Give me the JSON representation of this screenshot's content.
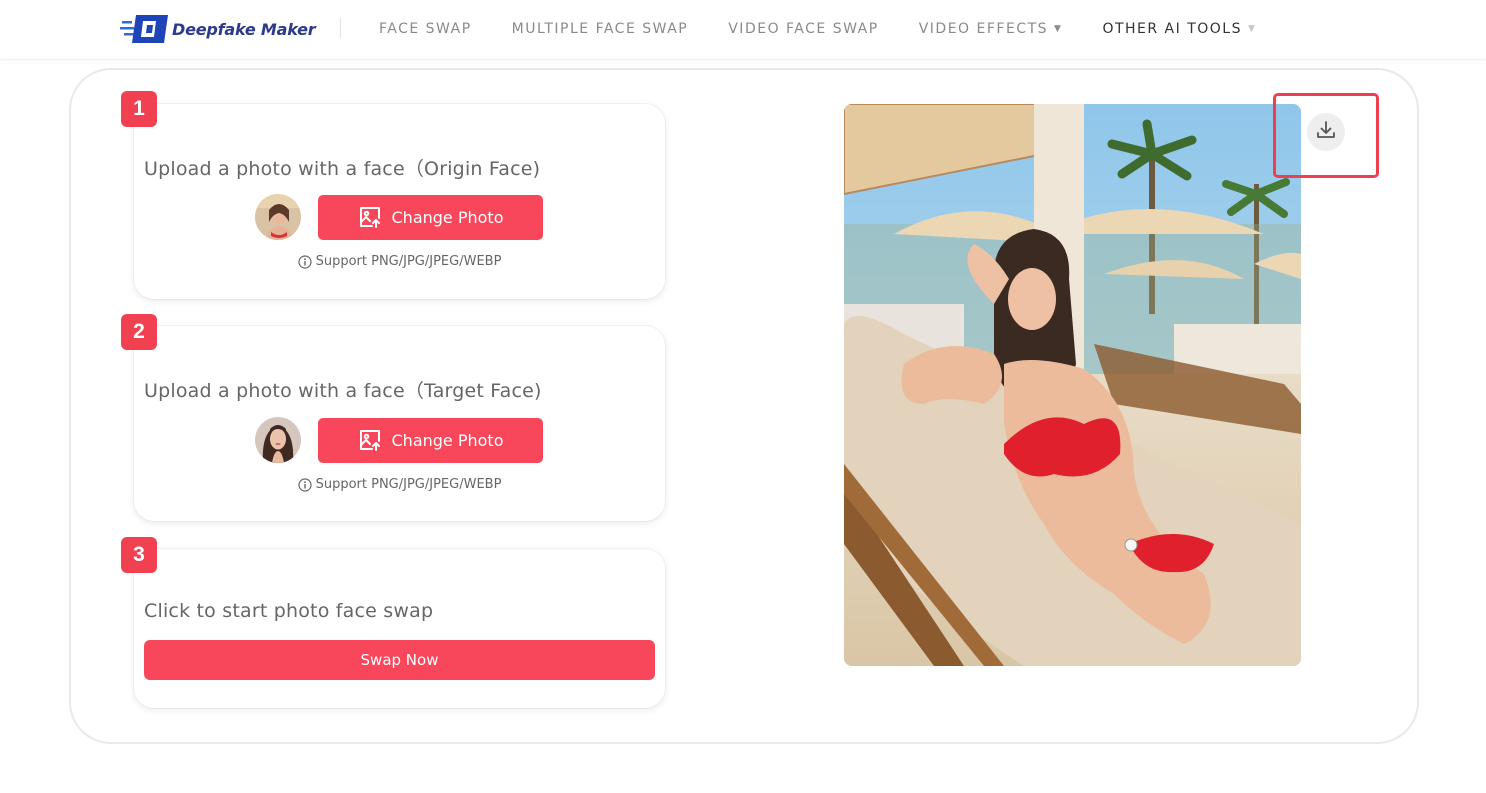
{
  "brand": {
    "name": "Deepfake Maker",
    "accent": "#f8475a",
    "logo_color": "#2d3a8c"
  },
  "nav": {
    "items": [
      {
        "label": "FACE SWAP",
        "has_caret": false
      },
      {
        "label": "MULTIPLE FACE SWAP",
        "has_caret": false
      },
      {
        "label": "VIDEO FACE SWAP",
        "has_caret": false
      },
      {
        "label": "VIDEO EFFECTS",
        "has_caret": true
      },
      {
        "label": "OTHER AI TOOLS",
        "has_caret": true
      }
    ]
  },
  "steps": [
    {
      "number": "1",
      "title": "Upload a photo with a face（Origin Face)",
      "button_label": "Change Photo",
      "support_text": "Support PNG/JPG/JPEG/WEBP",
      "button_icon": "image-upload-icon"
    },
    {
      "number": "2",
      "title": "Upload a photo with a face（Target Face)",
      "button_label": "Change Photo",
      "support_text": "Support PNG/JPG/JPEG/WEBP",
      "button_icon": "image-upload-icon"
    },
    {
      "number": "3",
      "title": "Click to start photo face swap",
      "button_label": "Swap Now"
    }
  ],
  "result": {
    "download_icon": "download-icon"
  }
}
